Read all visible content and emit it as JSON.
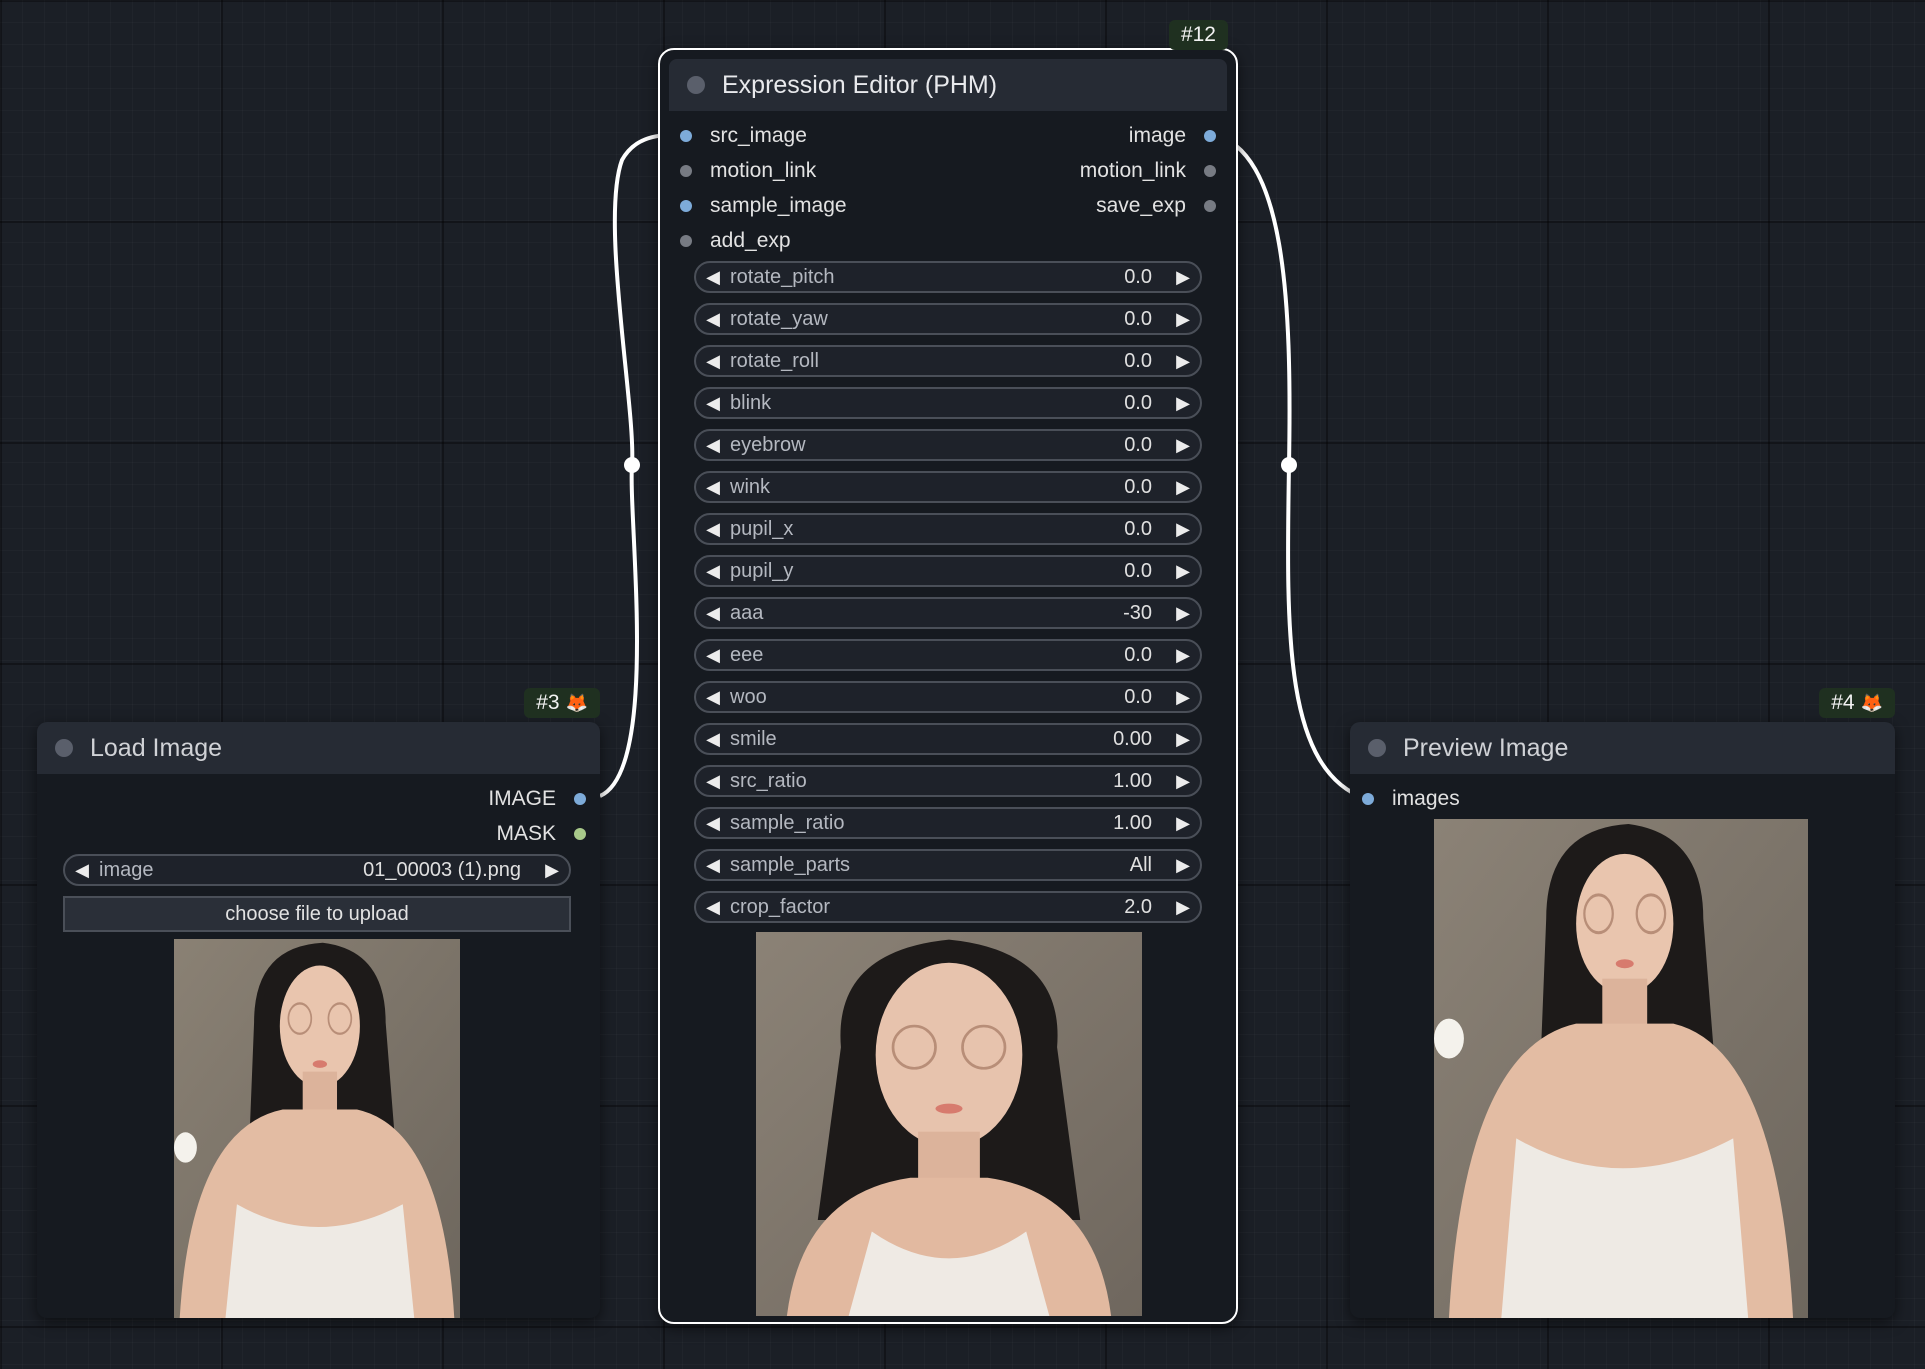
{
  "colors": {
    "canvas": "#1b1f26",
    "node_body": "#161a20",
    "node_header": "#262b34",
    "badge": "#1f3020",
    "slot_image": "#7dabd9",
    "slot_other": "#777b83",
    "slot_mask": "#a8c98a",
    "wire": "#ffffff"
  },
  "nodes": {
    "expression_editor": {
      "title": "Expression Editor (PHM)",
      "badge": "#12",
      "inputs": [
        "src_image",
        "motion_link",
        "sample_image",
        "add_exp"
      ],
      "outputs": [
        "image",
        "motion_link",
        "save_exp"
      ],
      "widgets": [
        {
          "label": "rotate_pitch",
          "value": "0.0"
        },
        {
          "label": "rotate_yaw",
          "value": "0.0"
        },
        {
          "label": "rotate_roll",
          "value": "0.0"
        },
        {
          "label": "blink",
          "value": "0.0"
        },
        {
          "label": "eyebrow",
          "value": "0.0"
        },
        {
          "label": "wink",
          "value": "0.0"
        },
        {
          "label": "pupil_x",
          "value": "0.0"
        },
        {
          "label": "pupil_y",
          "value": "0.0"
        },
        {
          "label": "aaa",
          "value": "-30"
        },
        {
          "label": "eee",
          "value": "0.0"
        },
        {
          "label": "woo",
          "value": "0.0"
        },
        {
          "label": "smile",
          "value": "0.00"
        },
        {
          "label": "src_ratio",
          "value": "1.00"
        },
        {
          "label": "sample_ratio",
          "value": "1.00"
        },
        {
          "label": "sample_parts",
          "value": "All"
        },
        {
          "label": "crop_factor",
          "value": "2.0"
        }
      ]
    },
    "load_image": {
      "title": "Load Image",
      "badge": "#3",
      "badge_icon": "fox-icon",
      "outputs": [
        "IMAGE",
        "MASK"
      ],
      "image_widget": {
        "label": "image",
        "value": "01_00003 (1).png"
      },
      "upload_label": "choose file to upload"
    },
    "preview_image": {
      "title": "Preview Image",
      "badge": "#4",
      "badge_icon": "fox-icon",
      "inputs": [
        "images"
      ]
    }
  }
}
